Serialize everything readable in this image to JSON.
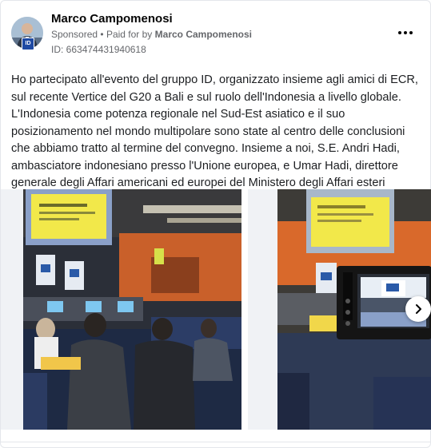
{
  "post": {
    "author": "Marco Campomenosi",
    "sponsored_label": "Sponsored",
    "separator": "•",
    "paid_for_prefix": "Paid for by",
    "paid_for_name": "Marco Campomenosi",
    "ad_id": "ID: 663474431940618",
    "text": "Ho partecipato all'evento del gruppo ID, organizzato insieme agli amici di ECR, sul recente Vertice del G20 a Bali e sul ruolo dell'Indonesia a livello globale. L'Indonesia come potenza regionale nel Sud-Est asiatico e il suo posizionamento nel mondo multipolare sono state al centro delle conclusioni che abbiamo tratto al termine del convegno. Insieme a noi, S.E. Andri Hadi, ambasciatore indonesiano presso l'Unione europea, e Umar Hadi, direttore generale degli Affari americani ed europei del Ministero degli Affari esteri indonesiano.…"
  },
  "icons": {
    "more": "more-options-icon",
    "next": "chevron-right-icon",
    "avatar_badge": "ID"
  },
  "colors": {
    "background": "#ffffff",
    "secondary_text": "#65676b",
    "slide_background": "#f0f2f5",
    "screen_yellow": "#f2e84a",
    "wall_orange": "#d9692b"
  }
}
